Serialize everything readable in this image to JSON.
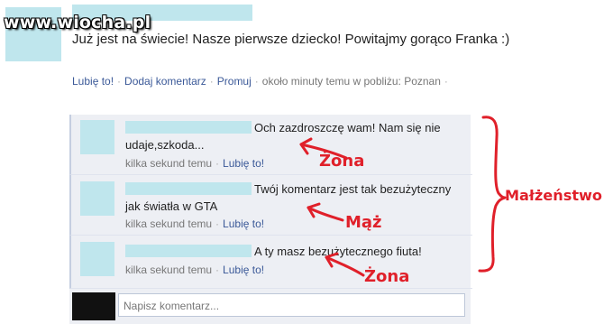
{
  "watermark": "www.wiocha.pl",
  "post": {
    "text": "Już jest na świecie! Nasze pierwsze dziecko! Powitajmy gorąco Franka :)",
    "like_label": "Lubię to!",
    "comment_label": "Dodaj komentarz",
    "promote_label": "Promuj",
    "meta": "około minuty temu w pobliżu: Poznan"
  },
  "comments": [
    {
      "text": "Och zazdroszczę wam! Nam się nie udaje,szkoda...",
      "time": "kilka sekund temu",
      "like_label": "Lubię to!"
    },
    {
      "text": "Twój komentarz jest tak bezużyteczny jak światła w GTA",
      "time": "kilka sekund temu",
      "like_label": "Lubię to!"
    },
    {
      "text": "A ty masz bezużytecznego fiuta!",
      "time": "kilka sekund temu",
      "like_label": "Lubię to!"
    }
  ],
  "write_comment": {
    "placeholder": "Napisz komentarz..."
  },
  "annotations": {
    "wife1": "Żona",
    "husband": "Mąż",
    "wife2": "Żona",
    "marriage": "Małżeństwo",
    "color": "#e0202a"
  },
  "colors": {
    "link": "#3b5998",
    "comment_bg": "#edeff4",
    "redaction": "#bfe6ed"
  }
}
